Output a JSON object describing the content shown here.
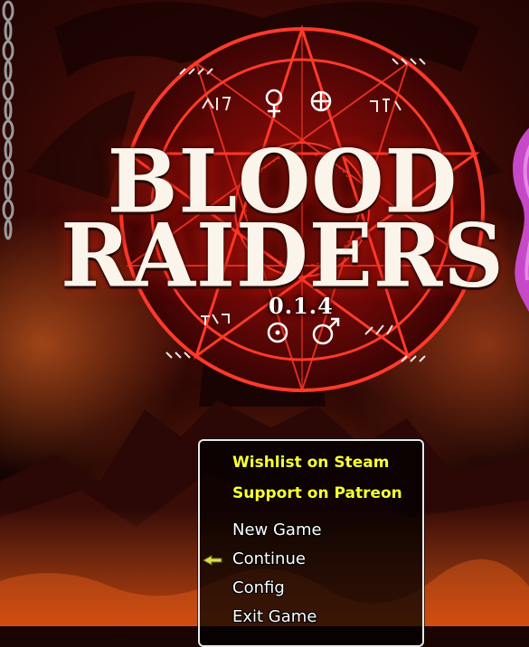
{
  "title": {
    "line1": "BLOOD",
    "line2": "RAIDERS",
    "version": "0.1.4"
  },
  "menu": {
    "items": [
      {
        "label": "Wishlist on Steam",
        "style": "highlight"
      },
      {
        "label": "Support on Patreon",
        "style": "highlight"
      },
      {
        "label": "New Game",
        "style": "normal"
      },
      {
        "label": "Continue",
        "style": "normal",
        "selected": true
      },
      {
        "label": "Config",
        "style": "normal"
      },
      {
        "label": "Exit Game",
        "style": "normal"
      }
    ],
    "cursor_icon": "arrow-pointer-icon"
  },
  "colors": {
    "highlight_text": "#ffff33",
    "normal_text": "#ffffff",
    "emblem_red": "#e0221a",
    "cursor": "#d8e24a"
  }
}
